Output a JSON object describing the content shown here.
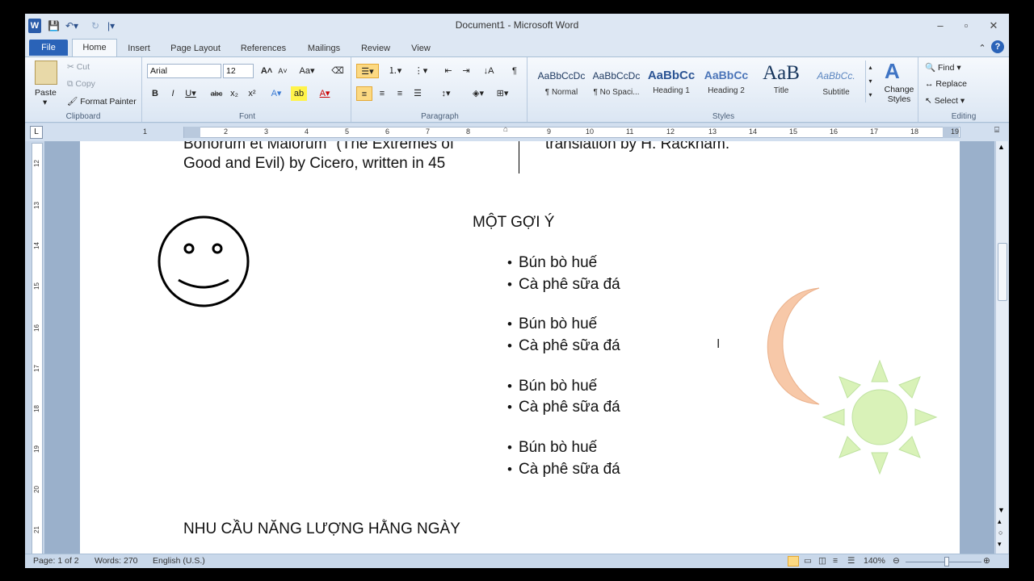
{
  "window": {
    "title": "Document1",
    "app": "Microsoft Word",
    "app_icon": "W"
  },
  "tabs": [
    "File",
    "Home",
    "Insert",
    "Page Layout",
    "References",
    "Mailings",
    "Review",
    "View"
  ],
  "ribbon": {
    "clipboard": {
      "label": "Clipboard",
      "paste": "Paste",
      "cut": "Cut",
      "copy": "Copy",
      "format_painter": "Format Painter"
    },
    "font": {
      "label": "Font",
      "family": "Arial",
      "size": "12"
    },
    "paragraph": {
      "label": "Paragraph"
    },
    "styles": {
      "label": "Styles",
      "items": [
        {
          "preview": "AaBbCcDc",
          "name": "¶ Normal"
        },
        {
          "preview": "AaBbCcDc",
          "name": "¶ No Spaci..."
        },
        {
          "preview": "AaBbCc",
          "name": "Heading 1"
        },
        {
          "preview": "AaBbCc",
          "name": "Heading 2"
        },
        {
          "preview": "AaB",
          "name": "Title"
        },
        {
          "preview": "AaBbCc.",
          "name": "Subtitle"
        }
      ],
      "change_styles": "Change Styles"
    },
    "editing": {
      "label": "Editing",
      "find": "Find",
      "replace": "Replace",
      "select": "Select"
    }
  },
  "ruler": {
    "h": [
      "1",
      "2",
      "3",
      "4",
      "5",
      "6",
      "7",
      "8",
      "9",
      "10",
      "11",
      "12",
      "13",
      "14",
      "15",
      "16",
      "17",
      "18",
      "19"
    ],
    "v": [
      "12",
      "13",
      "14",
      "15",
      "16",
      "17",
      "18",
      "19",
      "20",
      "21"
    ]
  },
  "document": {
    "col1_line1": "Bonorum et Malorum\" (The Extremes of",
    "col1_line2": "Good and Evil) by Cicero, written in 45",
    "col2_line1": "translation by H. Rackham.",
    "heading": "MỘT GỢI Ý",
    "list": [
      "Bún bò huế",
      "Cà phê sữa đá",
      "Bún bò huế",
      "Cà phê sữa đá",
      "Bún bò huế",
      "Cà phê sữa đá",
      "Bún bò huế",
      "Cà phê sữa đá"
    ],
    "heading2": "NHU CẦU NĂNG LƯỢNG HẰNG NGÀY"
  },
  "status": {
    "page": "Page: 1 of 2",
    "words": "Words: 270",
    "language": "English (U.S.)",
    "zoom": "140%"
  },
  "colors": {
    "file_tab": "#2a63b8",
    "moon": "#f7c8a8",
    "sun": "#d9f2b8"
  }
}
